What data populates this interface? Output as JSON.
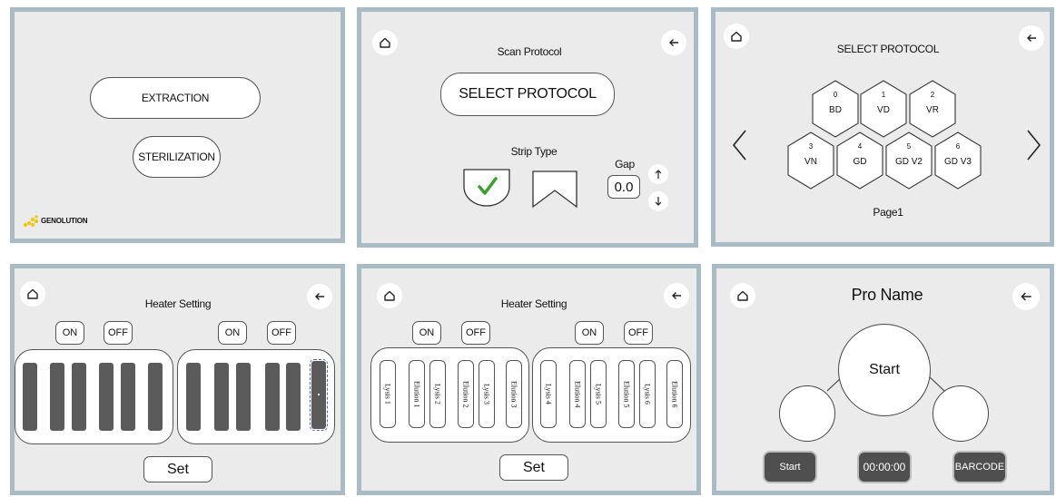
{
  "panel1": {
    "extraction_label": "EXTRACTION",
    "sterilization_label": "STERILIZATION",
    "brand": "GENOLUTION"
  },
  "panel2": {
    "title": "Scan Protocol",
    "select_protocol_label": "SELECT PROTOCOL",
    "strip_type_label": "Strip Type",
    "gap_label": "Gap",
    "gap_value": "0.0",
    "home_icon": "home-icon",
    "back_icon": "back-arrow-icon"
  },
  "panel3": {
    "title": "SELECT PROTOCOL",
    "protocols": [
      {
        "num": "0",
        "label": "BD"
      },
      {
        "num": "1",
        "label": "VD"
      },
      {
        "num": "2",
        "label": "VR"
      },
      {
        "num": "3",
        "label": "VN"
      },
      {
        "num": "4",
        "label": "GD"
      },
      {
        "num": "5",
        "label": "GD V2"
      },
      {
        "num": "6",
        "label": "GD V3"
      }
    ],
    "page_label": "Page1"
  },
  "panel4": {
    "title": "Heater Setting",
    "on_label": "ON",
    "off_label": "OFF",
    "set_label": "Set"
  },
  "panel5": {
    "title": "Heater Setting",
    "on_label": "ON",
    "off_label": "OFF",
    "set_label": "Set",
    "tubes": [
      "Lysis 1",
      "Elution 1",
      "Lysis 2",
      "Elution 2",
      "Lysis 3",
      "Elution 3",
      "Lysis 4",
      "Elution 4",
      "Lysis 5",
      "Elution 5",
      "Lysis 6",
      "Elution 6"
    ]
  },
  "panel6": {
    "title": "Pro Name",
    "center_label": "Start",
    "start_button": "Start",
    "timer": "00:00:00",
    "barcode_button": "BARCODE"
  },
  "colors": {
    "frame": "#a9bcc6",
    "panel_bg": "#ebebeb",
    "check_green": "#3aa12c",
    "dark_button": "#4f4f4f",
    "bar": "#5b5b5b",
    "brand_yellow": "#f2c500"
  }
}
